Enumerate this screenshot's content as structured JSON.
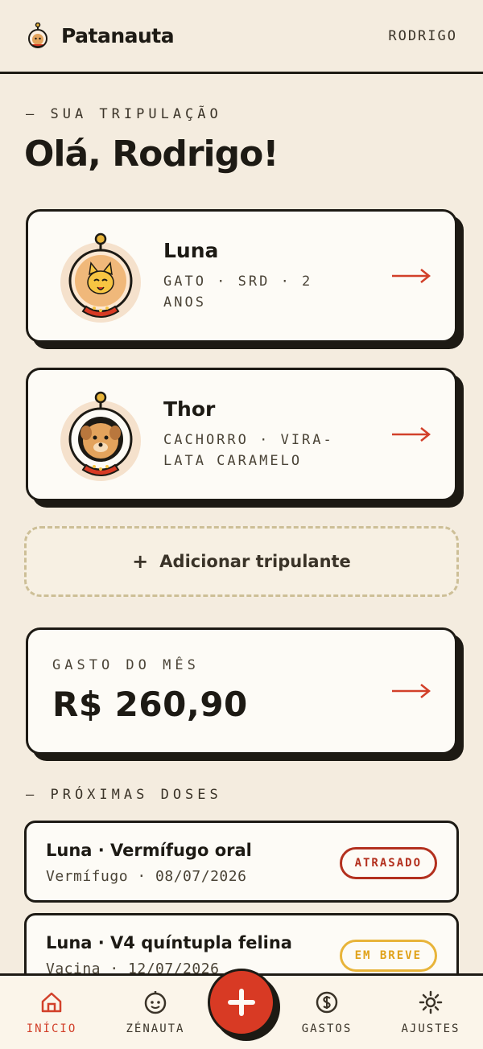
{
  "header": {
    "brand": "Patanauta",
    "user": "RODRIGO"
  },
  "crew": {
    "label": "— SUA TRIPULAÇÃO",
    "greeting": "Olá, Rodrigo!"
  },
  "pets": [
    {
      "name": "Luna",
      "meta": "GATO · SRD · 2 ANOS",
      "avatar": "cat-astronaut-icon"
    },
    {
      "name": "Thor",
      "meta": "CACHORRO · VIRA-LATA CARAMELO",
      "avatar": "dog-astronaut-icon"
    }
  ],
  "add_crew": {
    "label": "Adicionar tripulante"
  },
  "spend": {
    "label": "GASTO DO MÊS",
    "value": "R$ 260,90"
  },
  "doses": {
    "label": "— PRÓXIMAS DOSES",
    "items": [
      {
        "title": "Luna · Vermífugo oral",
        "sub": "Vermífugo · 08/07/2026",
        "status": "ATRASADO"
      },
      {
        "title": "Luna · V4 quíntupla felina",
        "sub": "Vacina · 12/07/2026",
        "status": "EM BREVE"
      }
    ]
  },
  "nav": {
    "items": [
      {
        "label": "INÍCIO",
        "icon": "home-icon",
        "active": true
      },
      {
        "label": "ZÉNAUTA",
        "icon": "face-icon"
      },
      {
        "label": "GASTOS",
        "icon": "money-icon"
      },
      {
        "label": "AJUSTES",
        "icon": "sun-gear-icon"
      }
    ],
    "fab_icon": "plus-icon"
  },
  "colors": {
    "accent": "#d83a24",
    "background": "#f4ecdf",
    "ink": "#1d1a14",
    "warning": "#e8b43a"
  }
}
